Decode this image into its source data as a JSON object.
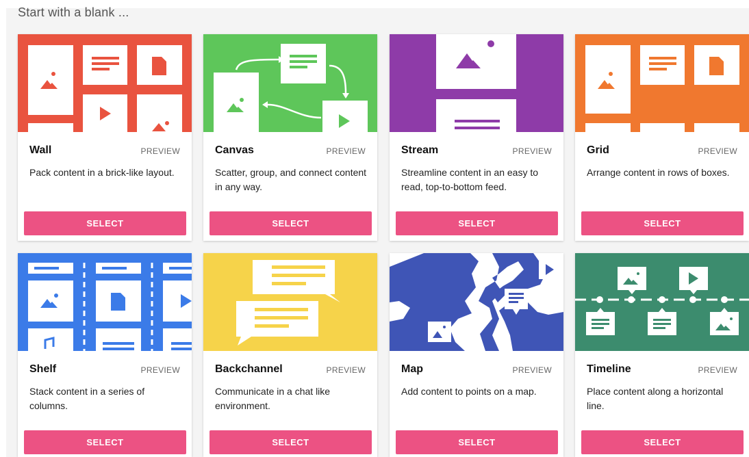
{
  "heading": "Start with a blank ...",
  "preview_label": "PREVIEW",
  "select_label": "SELECT",
  "cards": [
    {
      "title": "Wall",
      "description": "Pack content in a brick-like layout.",
      "color": "#e9533f"
    },
    {
      "title": "Canvas",
      "description": "Scatter, group, and connect content in any way.",
      "color": "#5ec65a"
    },
    {
      "title": "Stream",
      "description": "Streamline content in an easy to read, top-to-bottom feed.",
      "color": "#8e3ba8"
    },
    {
      "title": "Grid",
      "description": "Arrange content in rows of boxes.",
      "color": "#f0782f"
    },
    {
      "title": "Shelf",
      "description": "Stack content in a series of columns.",
      "color": "#3b7be8"
    },
    {
      "title": "Backchannel",
      "description": "Communicate in a chat like environment.",
      "color": "#f6d34a"
    },
    {
      "title": "Map",
      "description": "Add content to points on a map.",
      "color": "#3f55b6"
    },
    {
      "title": "Timeline",
      "description": "Place content along a horizontal line.",
      "color": "#3c8c6e"
    }
  ],
  "icons": [
    "image-icon",
    "text-lines-icon",
    "document-icon",
    "play-icon",
    "music-icon"
  ]
}
